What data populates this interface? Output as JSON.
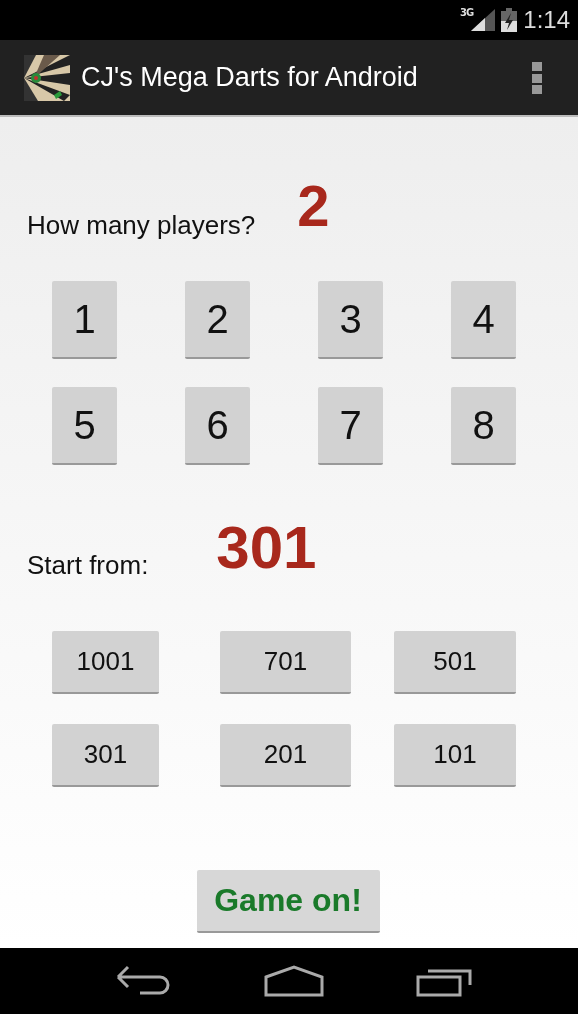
{
  "status_bar": {
    "network": "3G",
    "time": "1:14"
  },
  "app_bar": {
    "title": "CJ's Mega Darts for Android"
  },
  "players": {
    "label": "How many players?",
    "value": "2",
    "options": [
      "1",
      "2",
      "3",
      "4",
      "5",
      "6",
      "7",
      "8"
    ]
  },
  "start": {
    "label": "Start from:",
    "value": "301",
    "options": [
      "1001",
      "701",
      "501",
      "301",
      "201",
      "101"
    ]
  },
  "start_button": {
    "label": "Game on!"
  }
}
